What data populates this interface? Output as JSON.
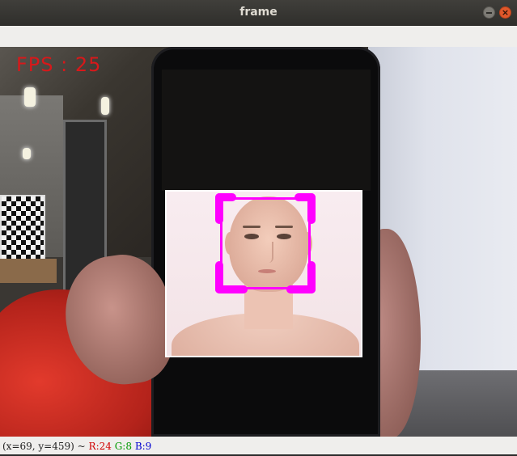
{
  "window": {
    "title": "frame"
  },
  "overlay": {
    "fps_text": "FPS : 25"
  },
  "detection": {
    "box_color": "#ff00ff"
  },
  "status": {
    "coords": "(x=69, y=459) ~",
    "r": "R:24",
    "g": "G:8",
    "b": "B:9"
  },
  "colors": {
    "fps": "#d8181a",
    "titlebar": "#3a3935",
    "close": "#e0582b"
  },
  "icons": {
    "close": "close-icon",
    "minimize": "minimize-icon"
  }
}
